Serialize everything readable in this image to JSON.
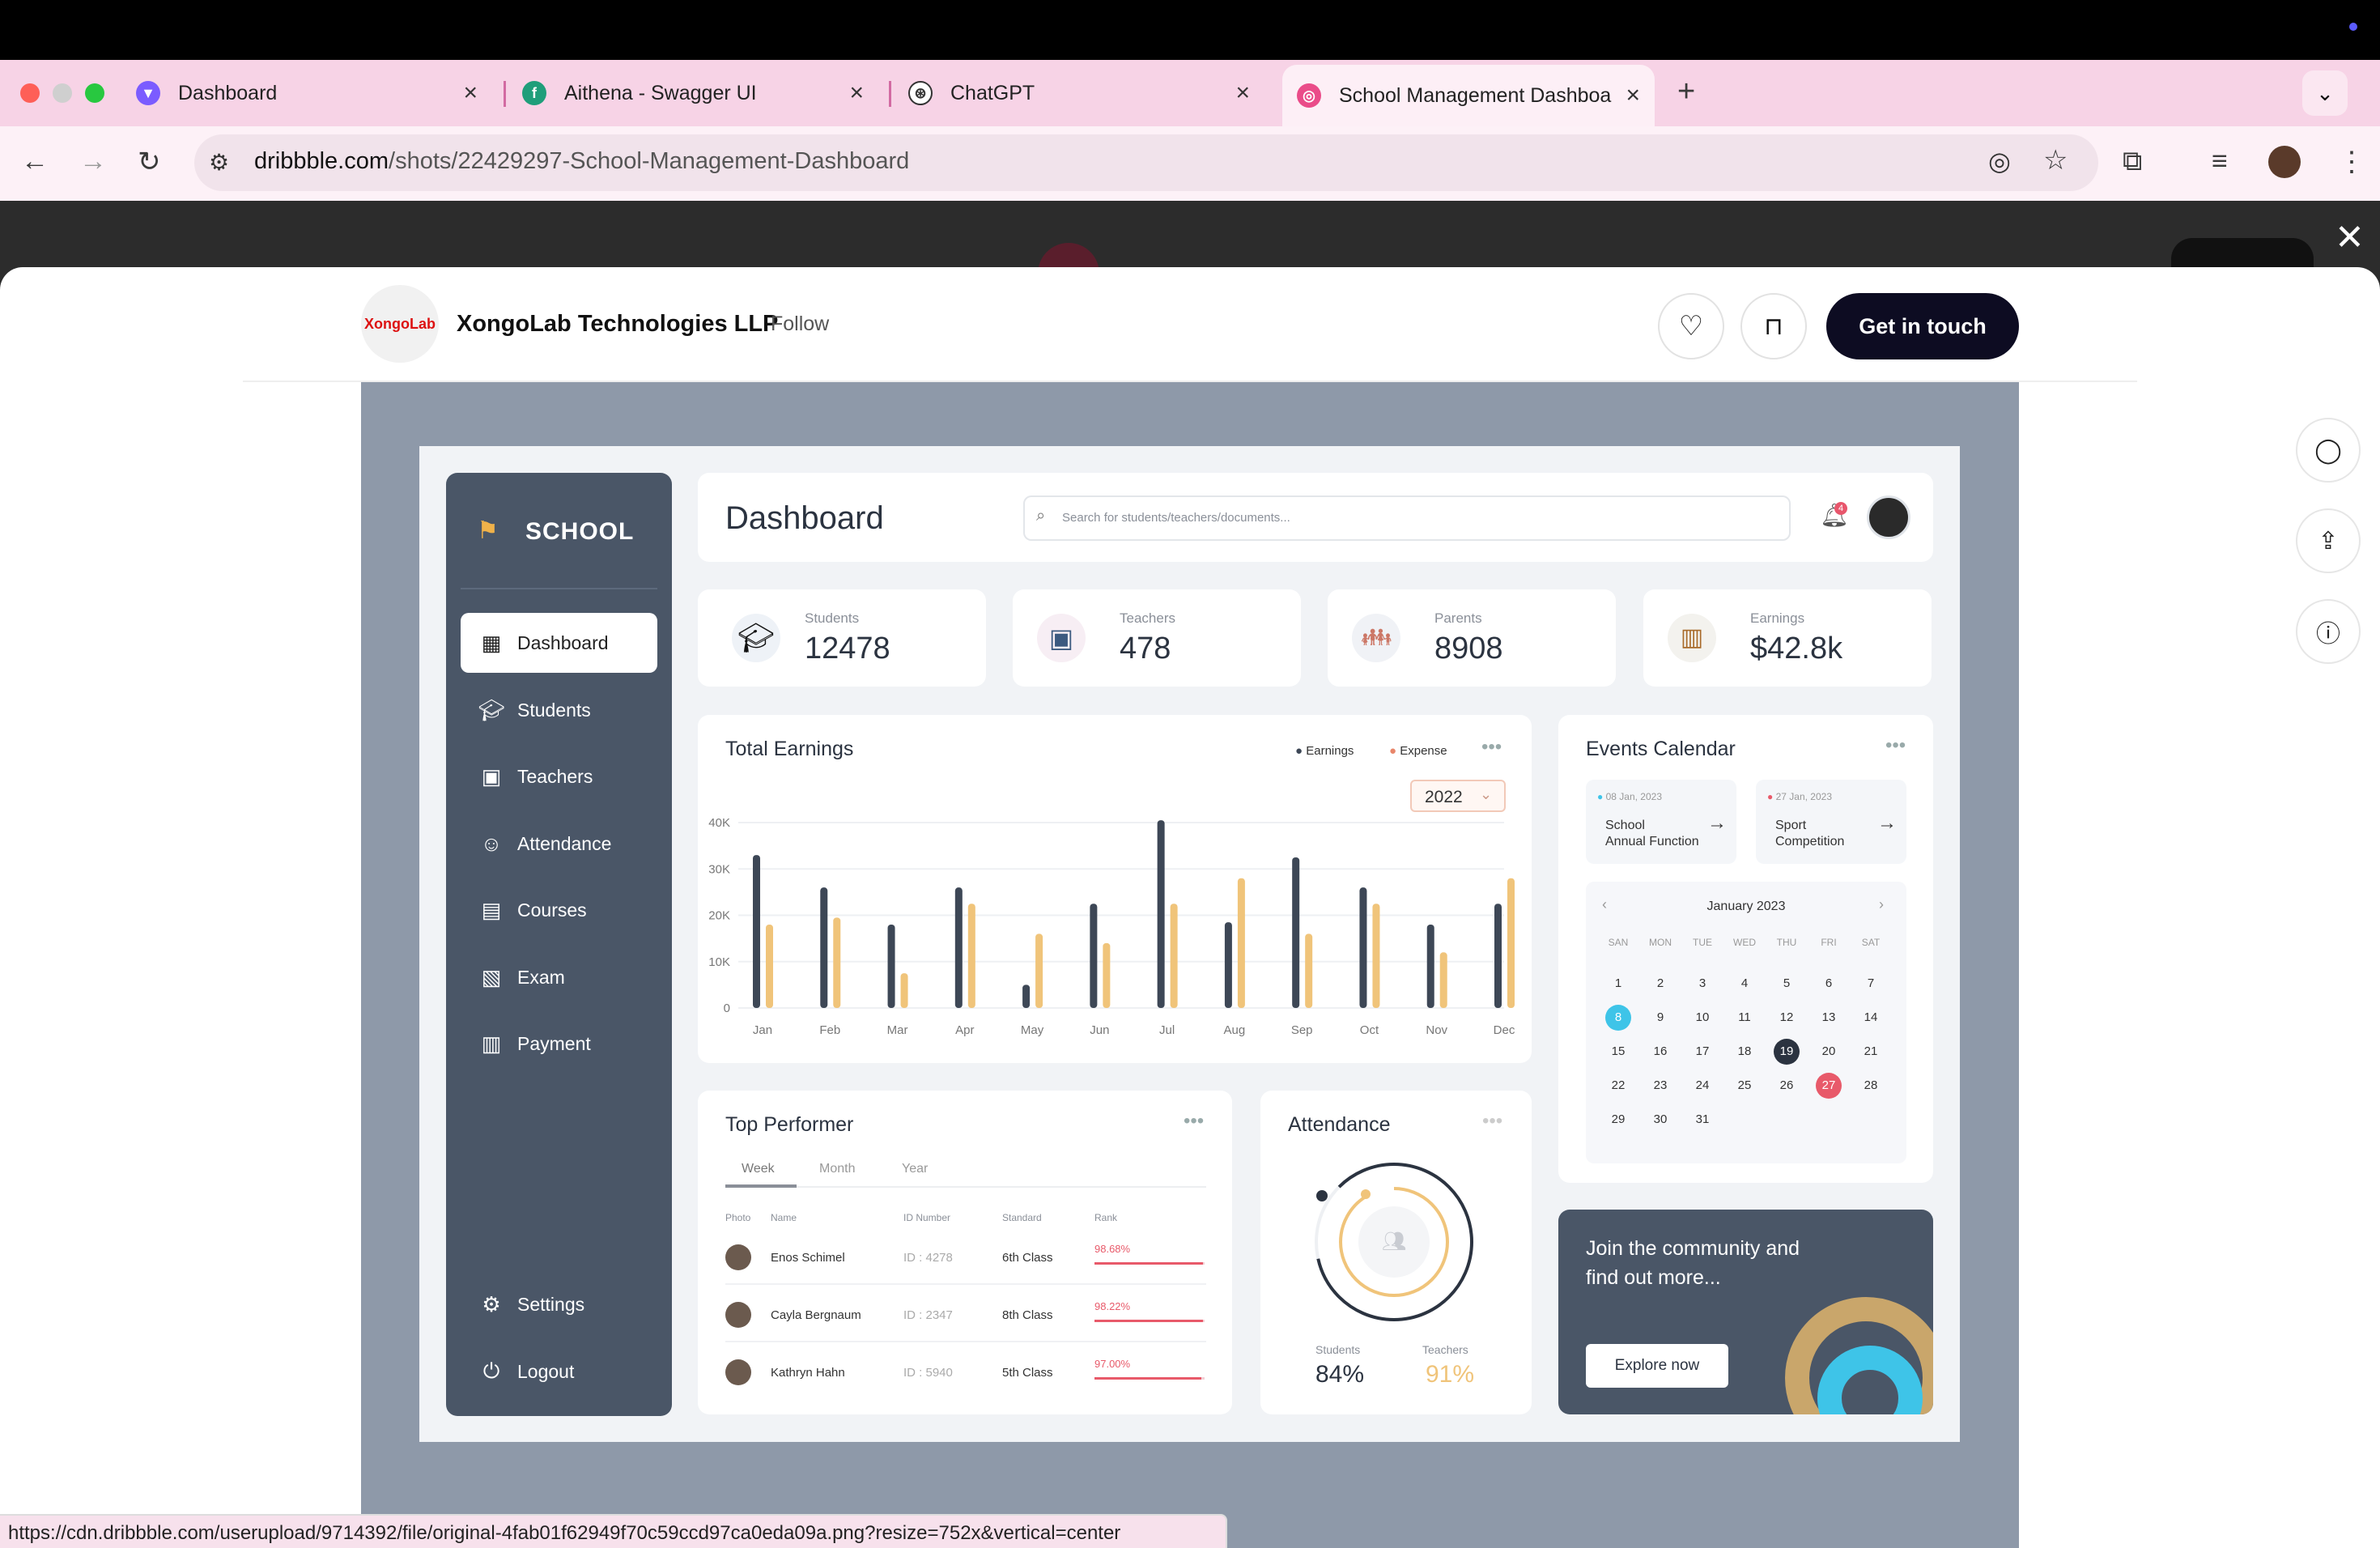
{
  "browser": {
    "tabs": [
      {
        "title": "Dashboard",
        "icon": "vite-icon"
      },
      {
        "title": "Aithena - Swagger UI",
        "icon": "swagger-icon"
      },
      {
        "title": "ChatGPT",
        "icon": "openai-icon"
      },
      {
        "title": "School Management Dashboa",
        "icon": "dribbble-icon"
      }
    ],
    "url_host": "dribbble.com",
    "url_path": "/shots/22429297-School-Management-Dashboard",
    "status_url": "https://cdn.dribbble.com/userupload/9714392/file/original-4fab01f62949f70c59ccd97ca0eda09a.png?resize=752x&vertical=center",
    "colors": {
      "tabstrip": "#f7d3e6",
      "toolbar": "#fdf1f7"
    }
  },
  "shot": {
    "author_logo": "XongoLab",
    "author": "XongoLab Technologies LLP",
    "follow": "Follow",
    "cta": "Get in touch"
  },
  "dashboard": {
    "brand": "SCHOOL",
    "title": "Dashboard",
    "search_placeholder": "Search for students/teachers/documents...",
    "notification_count": "4",
    "nav": [
      "Dashboard",
      "Students",
      "Teachers",
      "Attendance",
      "Courses",
      "Exam",
      "Payment"
    ],
    "nav_bottom": [
      "Settings",
      "Logout"
    ],
    "stats": [
      {
        "label": "Students",
        "value": "12478"
      },
      {
        "label": "Teachers",
        "value": "478"
      },
      {
        "label": "Parents",
        "value": "8908"
      },
      {
        "label": "Earnings",
        "value": "$42.8k"
      }
    ],
    "earnings": {
      "title": "Total Earnings",
      "legend": [
        "Earnings",
        "Expense"
      ],
      "year": "2022"
    },
    "events": {
      "title": "Events Calendar",
      "items": [
        {
          "date": "08 Jan, 2023",
          "title_1": "School",
          "title_2": "Annual Function"
        },
        {
          "date": "27 Jan, 2023",
          "title_1": "Sport",
          "title_2": "Competition"
        }
      ],
      "month": "January 2023",
      "weekdays": [
        "SAN",
        "MON",
        "TUE",
        "WED",
        "THU",
        "FRI",
        "SAT"
      ]
    },
    "performer": {
      "title": "Top Performer",
      "tabs": [
        "Week",
        "Month",
        "Year"
      ],
      "columns": [
        "Photo",
        "Name",
        "ID Number",
        "Standard",
        "Rank"
      ],
      "rows": [
        {
          "name": "Enos Schimel",
          "id": "ID : 4278",
          "standard": "6th Class",
          "rank": "98.68%"
        },
        {
          "name": "Cayla Bergnaum",
          "id": "ID : 2347",
          "standard": "8th Class",
          "rank": "98.22%"
        },
        {
          "name": "Kathryn Hahn",
          "id": "ID : 5940",
          "standard": "5th Class",
          "rank": "97.00%"
        }
      ]
    },
    "attendance": {
      "title": "Attendance",
      "students_label": "Students",
      "students_value": "84%",
      "teachers_label": "Teachers",
      "teachers_value": "91%"
    },
    "community": {
      "line1": "Join the community and",
      "line2": "find out more...",
      "button": "Explore now"
    }
  },
  "chart_data": {
    "type": "bar",
    "title": "Total Earnings",
    "categories": [
      "Jan",
      "Feb",
      "Mar",
      "Apr",
      "May",
      "Jun",
      "Jul",
      "Aug",
      "Sep",
      "Oct",
      "Nov",
      "Dec"
    ],
    "series": [
      {
        "name": "Earnings",
        "color": "#3d4756",
        "values": [
          33000,
          26000,
          18000,
          26000,
          5000,
          22500,
          40500,
          18500,
          32500,
          26000,
          18000,
          22500
        ]
      },
      {
        "name": "Expense",
        "color": "#f0c47a",
        "values": [
          18000,
          19500,
          7500,
          22500,
          16000,
          14000,
          22500,
          28000,
          16000,
          22500,
          12000,
          28000
        ]
      }
    ],
    "yticks": [
      "0",
      "10K",
      "20K",
      "30K",
      "40K"
    ],
    "ylim": [
      0,
      40000
    ],
    "grid": true,
    "legend": "top-right"
  }
}
